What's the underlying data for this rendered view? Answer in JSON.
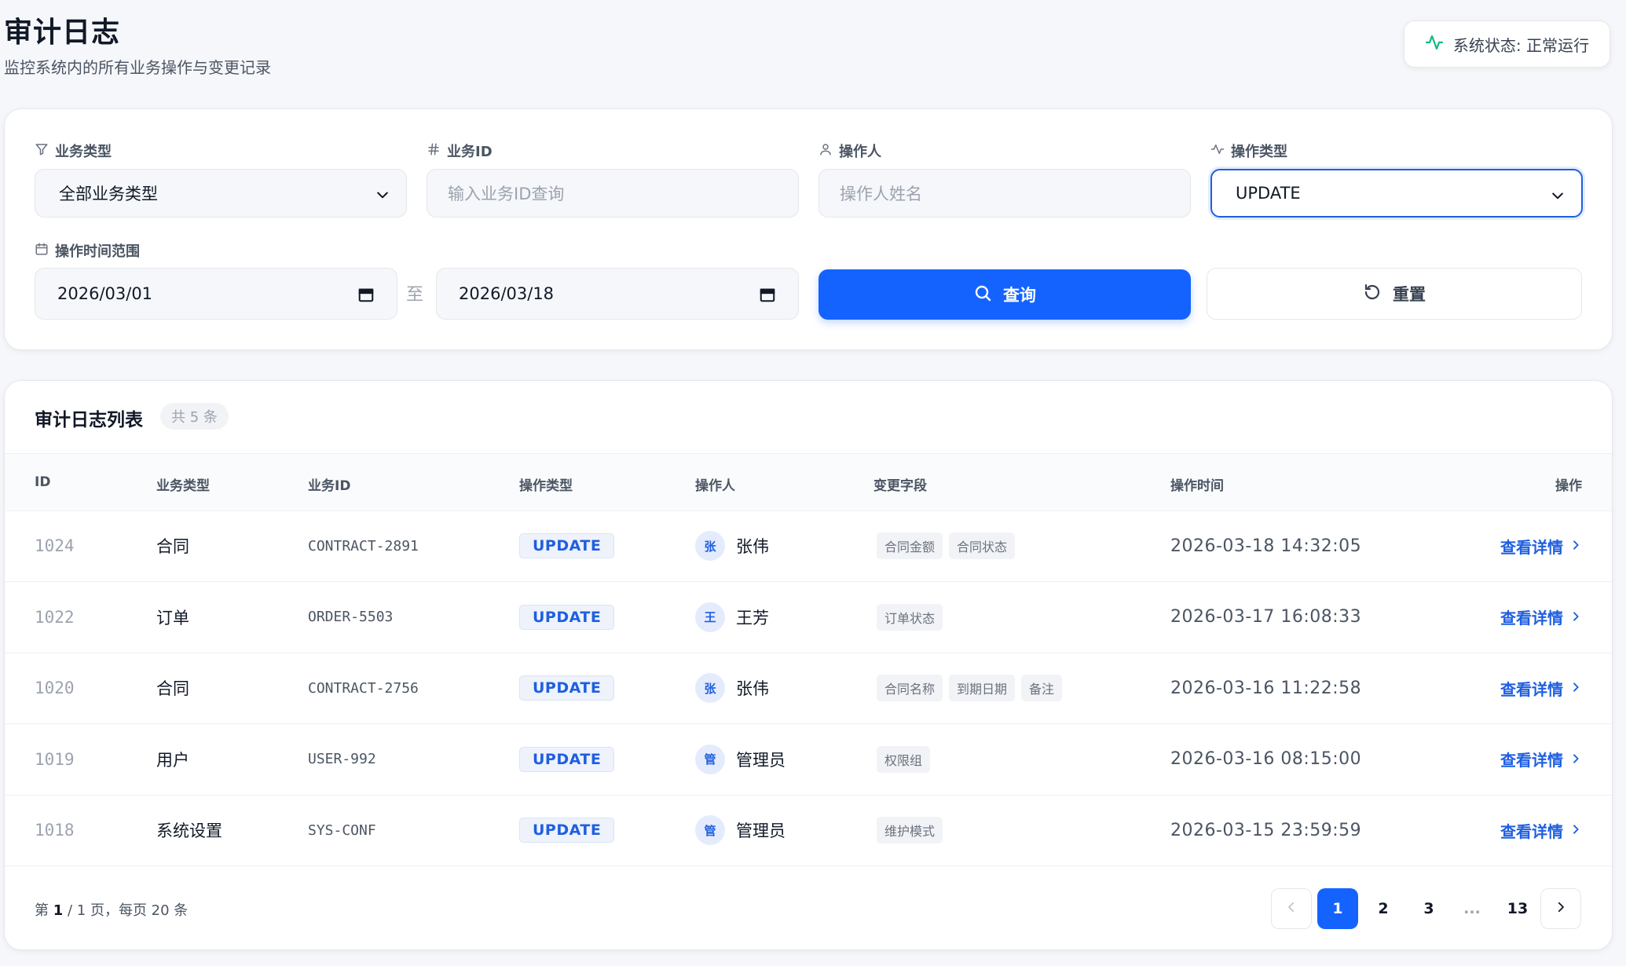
{
  "header": {
    "title": "审计日志",
    "subtitle": "监控系统内的所有业务操作与变更记录",
    "status_text": "系统状态: 正常运行"
  },
  "filters": {
    "business_type": {
      "label": "业务类型",
      "value": "全部业务类型"
    },
    "business_id": {
      "label": "业务ID",
      "placeholder": "输入业务ID查询"
    },
    "operator": {
      "label": "操作人",
      "placeholder": "操作人姓名"
    },
    "operation_type": {
      "label": "操作类型",
      "value": "UPDATE"
    },
    "time_range": {
      "label": "操作时间范围",
      "start": "2026/03/01",
      "separator": "至",
      "end": "2026/03/18"
    },
    "search_label": "查询",
    "reset_label": "重置"
  },
  "list": {
    "title": "审计日志列表",
    "count_badge": "共 5 条",
    "columns": [
      "ID",
      "业务类型",
      "业务ID",
      "操作类型",
      "操作人",
      "变更字段",
      "操作时间",
      "操作"
    ],
    "detail_label": "查看详情",
    "rows": [
      {
        "id": "1024",
        "biz_type": "合同",
        "biz_id": "CONTRACT-2891",
        "op_type": "UPDATE",
        "avatar": "张",
        "operator": "张伟",
        "fields": [
          "合同金额",
          "合同状态"
        ],
        "time": "2026-03-18 14:32:05"
      },
      {
        "id": "1022",
        "biz_type": "订单",
        "biz_id": "ORDER-5503",
        "op_type": "UPDATE",
        "avatar": "王",
        "operator": "王芳",
        "fields": [
          "订单状态"
        ],
        "time": "2026-03-17 16:08:33"
      },
      {
        "id": "1020",
        "biz_type": "合同",
        "biz_id": "CONTRACT-2756",
        "op_type": "UPDATE",
        "avatar": "张",
        "operator": "张伟",
        "fields": [
          "合同名称",
          "到期日期",
          "备注"
        ],
        "time": "2026-03-16 11:22:58"
      },
      {
        "id": "1019",
        "biz_type": "用户",
        "biz_id": "USER-992",
        "op_type": "UPDATE",
        "avatar": "管",
        "operator": "管理员",
        "fields": [
          "权限组"
        ],
        "time": "2026-03-16 08:15:00"
      },
      {
        "id": "1018",
        "biz_type": "系统设置",
        "biz_id": "SYS-CONF",
        "op_type": "UPDATE",
        "avatar": "管",
        "operator": "管理员",
        "fields": [
          "维护模式"
        ],
        "time": "2026-03-15 23:59:59"
      }
    ]
  },
  "pagination": {
    "info_prefix": "第 ",
    "current_page": "1",
    "info_suffix": " / 1 页，每页 20 条",
    "pages": [
      "1",
      "2",
      "3",
      "...",
      "13"
    ]
  },
  "colors": {
    "primary": "#1463ff",
    "status_green": "#10b981",
    "link": "#1f5fe0"
  },
  "icons": [
    "activity-icon",
    "filter-icon",
    "hash-icon",
    "user-icon",
    "pulse-icon",
    "calendar-icon",
    "search-icon",
    "refresh-icon",
    "chevron-right-icon",
    "chevron-left-icon",
    "chevron-down-icon"
  ]
}
